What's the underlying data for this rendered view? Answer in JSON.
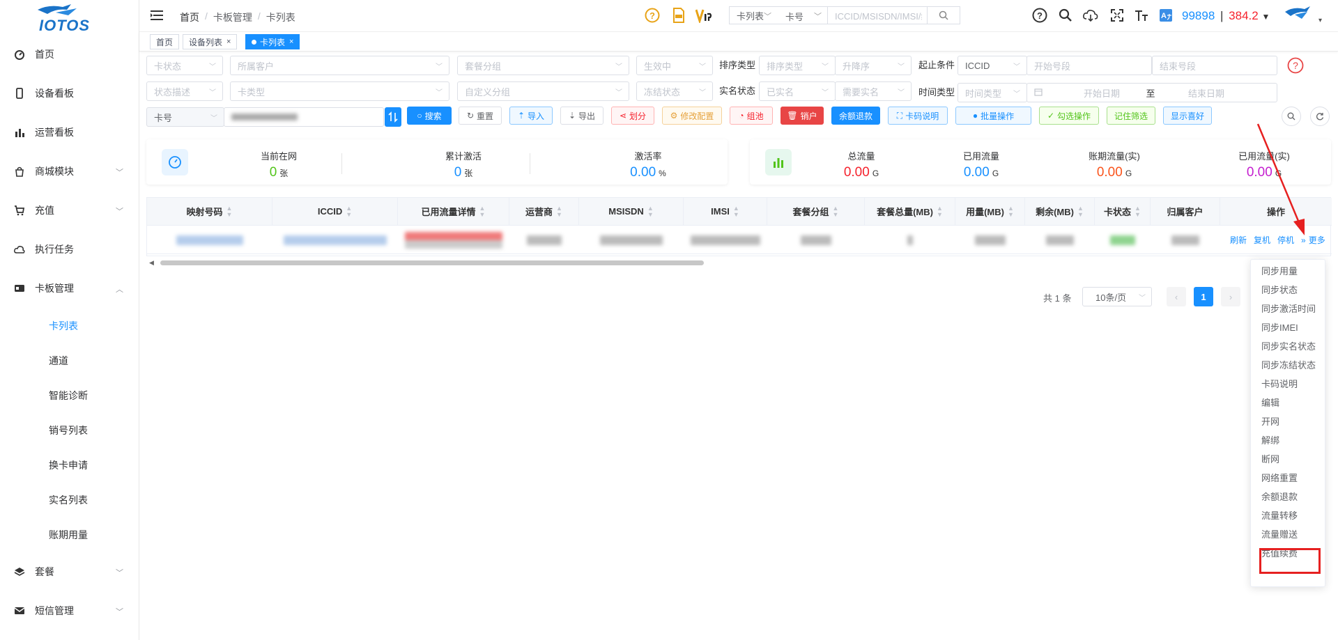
{
  "brand": {
    "logo_text": "IOTOS"
  },
  "sidebar": {
    "items": [
      {
        "label": "首页",
        "icon": "dashboard-icon"
      },
      {
        "label": "设备看板",
        "icon": "phone-icon"
      },
      {
        "label": "运营看板",
        "icon": "bar-chart-icon"
      },
      {
        "label": "商城模块",
        "icon": "shopping-bag-icon",
        "has_children": true
      },
      {
        "label": "充值",
        "icon": "cart-icon",
        "has_children": true
      },
      {
        "label": "执行任务",
        "icon": "cloud-icon"
      },
      {
        "label": "卡板管理",
        "icon": "card-icon",
        "expanded": true
      },
      {
        "label": "套餐",
        "icon": "layers-icon",
        "has_children": true
      },
      {
        "label": "短信管理",
        "icon": "mail-icon",
        "has_children": true
      }
    ],
    "submenu": [
      {
        "label": "卡列表",
        "active": true
      },
      {
        "label": "通道"
      },
      {
        "label": "智能诊断"
      },
      {
        "label": "销号列表"
      },
      {
        "label": "换卡申请"
      },
      {
        "label": "实名列表"
      },
      {
        "label": "账期用量"
      }
    ]
  },
  "header": {
    "breadcrumb": [
      "首页",
      "卡板管理",
      "卡列表"
    ],
    "search": {
      "scope": "卡列表",
      "field": "卡号",
      "placeholder": "ICCID/MSISDN/IMSI/编号"
    },
    "balance_blue": "99898",
    "balance_sep": "|",
    "balance_red": "384.2"
  },
  "tags": [
    {
      "label": "首页"
    },
    {
      "label": "设备列表"
    },
    {
      "label": "卡列表",
      "active": true
    }
  ],
  "filters": {
    "row1": {
      "card_status": "卡状态",
      "customer": "所属客户",
      "package_group": "套餐分组",
      "effective": "生效中",
      "sort_label": "排序类型",
      "sort_type": "排序类型",
      "sort_order": "升降序",
      "range_label": "起止条件",
      "range_field": "ICCID",
      "start_no": "开始号段",
      "end_no": "结束号段"
    },
    "row2": {
      "status_desc": "状态描述",
      "card_type": "卡类型",
      "custom_group": "自定义分组",
      "freeze_status": "冻结状态",
      "realname_label": "实名状态",
      "realname": "已实名",
      "need_realname": "需要实名",
      "time_label": "时间类型",
      "time_type": "时间类型",
      "start_date": "开始日期",
      "date_sep": "至",
      "end_date": "结束日期"
    },
    "row3": {
      "field": "卡号"
    }
  },
  "toolbar": [
    {
      "label": "搜索",
      "icon": "search-icon",
      "style": "primary"
    },
    {
      "label": "重置",
      "icon": "refresh-icon",
      "style": "default"
    },
    {
      "label": "导入",
      "icon": "upload-icon",
      "style": "info"
    },
    {
      "label": "导出",
      "icon": "download-icon",
      "style": "default"
    },
    {
      "label": "划分",
      "icon": "share-icon",
      "style": "danger"
    },
    {
      "label": "修改配置",
      "icon": "gear-icon",
      "style": "warning"
    },
    {
      "label": "组池",
      "icon": "pie-icon",
      "style": "danger"
    },
    {
      "label": "销户",
      "icon": "trash-icon",
      "style": "danger-solid"
    },
    {
      "label": "余额退款",
      "icon": "",
      "style": "primary"
    },
    {
      "label": "卡码说明",
      "icon": "scan-icon",
      "style": "info"
    },
    {
      "label": "批量操作",
      "icon": "user-icon",
      "style": "info"
    },
    {
      "label": "勾选操作",
      "icon": "check-icon",
      "style": "success"
    },
    {
      "label": "记住筛选",
      "icon": "",
      "style": "success"
    },
    {
      "label": "显示喜好",
      "icon": "",
      "style": "info"
    }
  ],
  "stats_left": [
    {
      "label": "当前在网",
      "value": "0",
      "unit": "张",
      "color": "#52c41a"
    },
    {
      "label": "累计激活",
      "value": "0",
      "unit": "张",
      "color": "#1890ff"
    },
    {
      "label": "激活率",
      "value": "0.00",
      "unit": "%",
      "color": "#1890ff"
    }
  ],
  "stats_right": [
    {
      "label": "总流量",
      "value": "0.00",
      "unit": "G",
      "color": "#f5222d"
    },
    {
      "label": "已用流量",
      "value": "0.00",
      "unit": "G",
      "color": "#1890ff"
    },
    {
      "label": "账期流量(实)",
      "value": "0.00",
      "unit": "G",
      "color": "#fa541c"
    },
    {
      "label": "已用流量(实)",
      "value": "0.00",
      "unit": "G",
      "color": "#c41dcf"
    }
  ],
  "table": {
    "columns": [
      "映射号码",
      "ICCID",
      "已用流量详情",
      "运营商",
      "MSISDN",
      "IMSI",
      "套餐分组",
      "套餐总量(MB)",
      "用量(MB)",
      "剩余(MB)",
      "卡状态",
      "归属客户",
      "操作"
    ],
    "row_actions": [
      "刷新",
      "复机",
      "停机",
      "更多"
    ]
  },
  "pagination": {
    "total": "共 1 条",
    "page_size": "10条/页",
    "current": "1"
  },
  "more_menu": [
    "同步用量",
    "同步状态",
    "同步激活时间",
    "同步IMEI",
    "同步实名状态",
    "同步冻结状态",
    "卡码说明",
    "编辑",
    "开网",
    "解绑",
    "断网",
    "网络重置",
    "余额退款",
    "流量转移",
    "流量赠送",
    "充值续费"
  ]
}
